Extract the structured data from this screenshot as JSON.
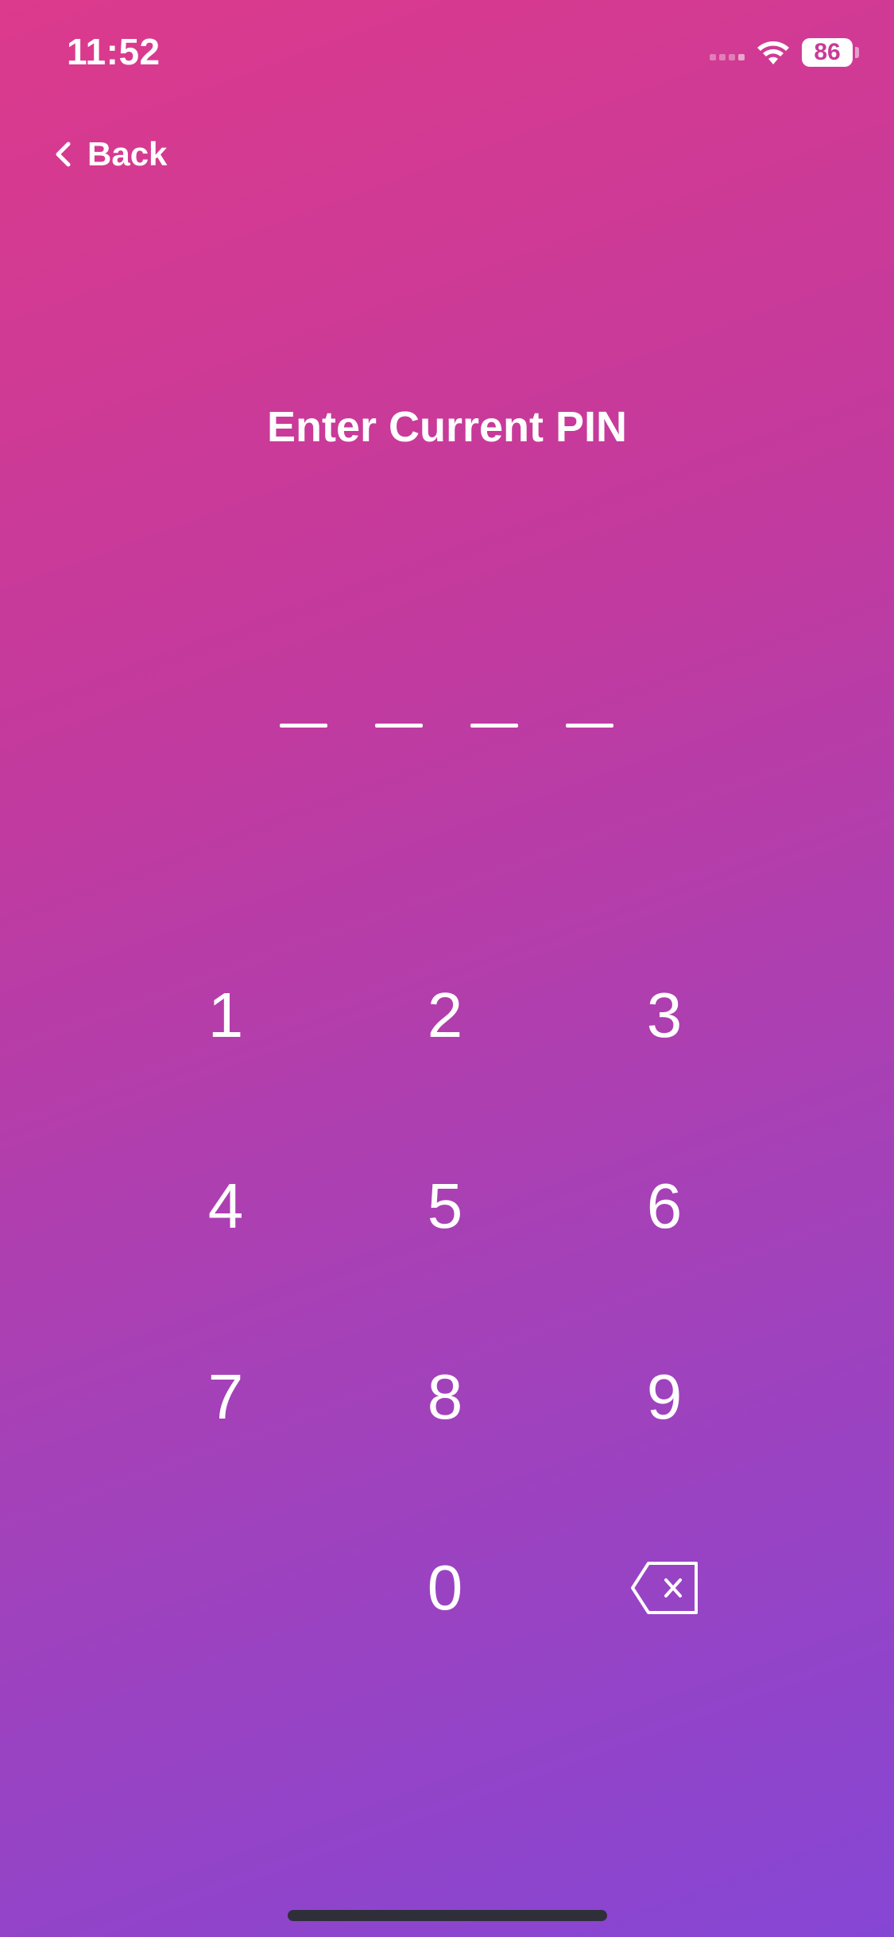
{
  "status_bar": {
    "time": "11:52",
    "battery_level": "86",
    "signal_icon": "cellular-signal-icon",
    "wifi_icon": "wifi-icon",
    "battery_icon": "battery-icon"
  },
  "nav": {
    "back_label": "Back",
    "back_icon": "chevron-left-icon"
  },
  "title": "Enter Current PIN",
  "pin": {
    "length": 4,
    "entered": 0
  },
  "keypad": {
    "keys": [
      "1",
      "2",
      "3",
      "4",
      "5",
      "6",
      "7",
      "8",
      "9",
      "0"
    ],
    "delete_icon": "backspace-icon"
  },
  "colors": {
    "gradient_start": "#dc3a8c",
    "gradient_end": "#8646d4",
    "text": "#ffffff"
  }
}
